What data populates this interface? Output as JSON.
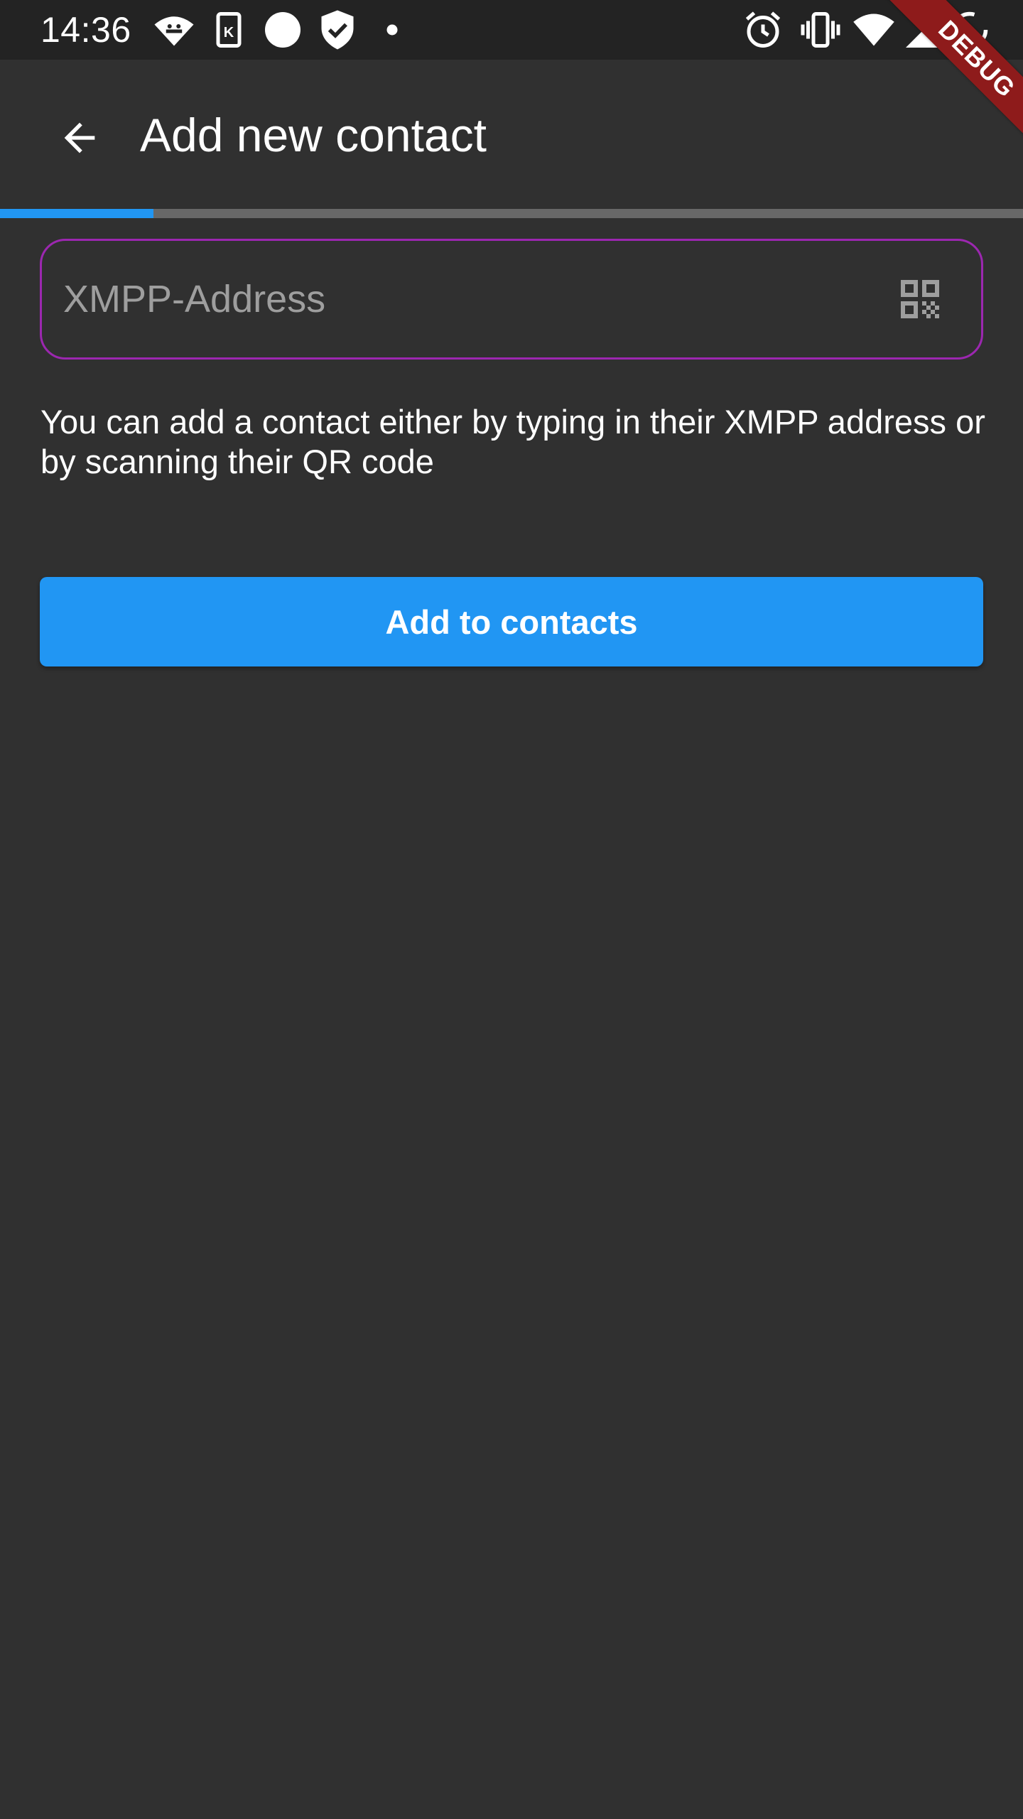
{
  "status_bar": {
    "time": "14:36",
    "left_icons": [
      "android-notification-icon",
      "k-app-icon",
      "circle-icon",
      "shield-check-icon",
      "dot-icon"
    ],
    "right_icons": [
      "alarm-icon",
      "vibrate-icon",
      "wifi-icon",
      "signal-icon",
      "battery-icon"
    ]
  },
  "app_bar": {
    "back_icon": "arrow-back-icon",
    "title": "Add new contact"
  },
  "progress": {
    "value": 0.15,
    "color": "#2196f3"
  },
  "address_field": {
    "value": "",
    "placeholder": "XMPP-Address",
    "trailing_icon": "qr-code-icon",
    "border_color": "#9c27b0"
  },
  "help_text": "You can add a contact either by typing in their XMPP address or by scanning their QR code",
  "add_button": {
    "label": "Add to contacts",
    "color": "#2196f3"
  },
  "debug_banner": {
    "label": "DEBUG",
    "color": "#8e1b1b"
  },
  "colors": {
    "background": "#303030",
    "status_bar": "#232323"
  }
}
